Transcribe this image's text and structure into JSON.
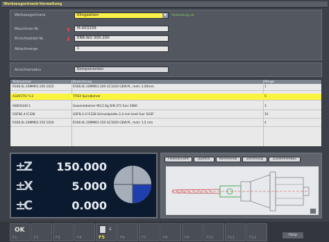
{
  "window": {
    "title": "Werkzeugschrank-Verwaltung"
  },
  "form": {
    "cabinet": {
      "label": "Werkzeugschrank",
      "value": "Klingseisen",
      "status": "Verbindung ok"
    },
    "machine_no": {
      "label": "Maschinen-Nr.",
      "value": "M-003209"
    },
    "setup_sheet": {
      "label": "Einrichteblatt-Nr.",
      "value": "ERB-W2-300-200"
    },
    "sequence": {
      "label": "Ablaufmenge",
      "value": "1"
    },
    "view_mode": {
      "label": "Ansichtsmodus",
      "value": "Komponenten"
    }
  },
  "table": {
    "columns": [
      "Teilenummer",
      "Bezeichnung",
      "Menge"
    ],
    "rows": [
      {
        "part": "R166.0L-16MM01-200 1025",
        "desc": "R166.0L-16MM01-200 GC1020 GEW.PL. metr. 2,00mm",
        "qty": "1"
      },
      {
        "part": "A3265TFL*3.2",
        "desc": "TITEX Spiralbohrer",
        "qty": "5"
      },
      {
        "part": "60819340-1",
        "desc": "Gewindebohrer M3,5 6g DIN 371 fuer 2966",
        "qty": "3"
      },
      {
        "part": "GSFN2.4 IC328",
        "desc": "GSFN 2.4 IC328 Schneidplatte 2,4 mm breit fuer SGSF",
        "qty": "10"
      },
      {
        "part": "R166.0L-16MM01-150 1020",
        "desc": "R166.0L-16MM01-150 GC1020 GEW.PL. metr. 1,5 mm",
        "qty": "4"
      }
    ],
    "selected_index": 1
  },
  "dro": {
    "axes": [
      {
        "name": "Z",
        "value": "150.000"
      },
      {
        "name": "X",
        "value": "5.000"
      },
      {
        "name": "C",
        "value": "0.000"
      }
    ]
  },
  "preview": {
    "tabs": [
      "Folienansicht",
      "Joystick",
      "Kommentar",
      "Zeichnung",
      "Zusammenbau"
    ]
  },
  "fkeys": [
    "F1",
    "F2",
    "F3",
    "F4",
    "F5",
    "F6",
    "F7",
    "F8",
    "F9",
    "F10",
    "F11",
    "F12"
  ],
  "fkey_active": "F5",
  "f1_caption": "OK",
  "help_label": "Help",
  "colors": {
    "highlight": "#fbf43e",
    "accent_yellow": "#f2df44",
    "status_green": "#7fd16a",
    "dro_bg": "#0b1a2f"
  }
}
